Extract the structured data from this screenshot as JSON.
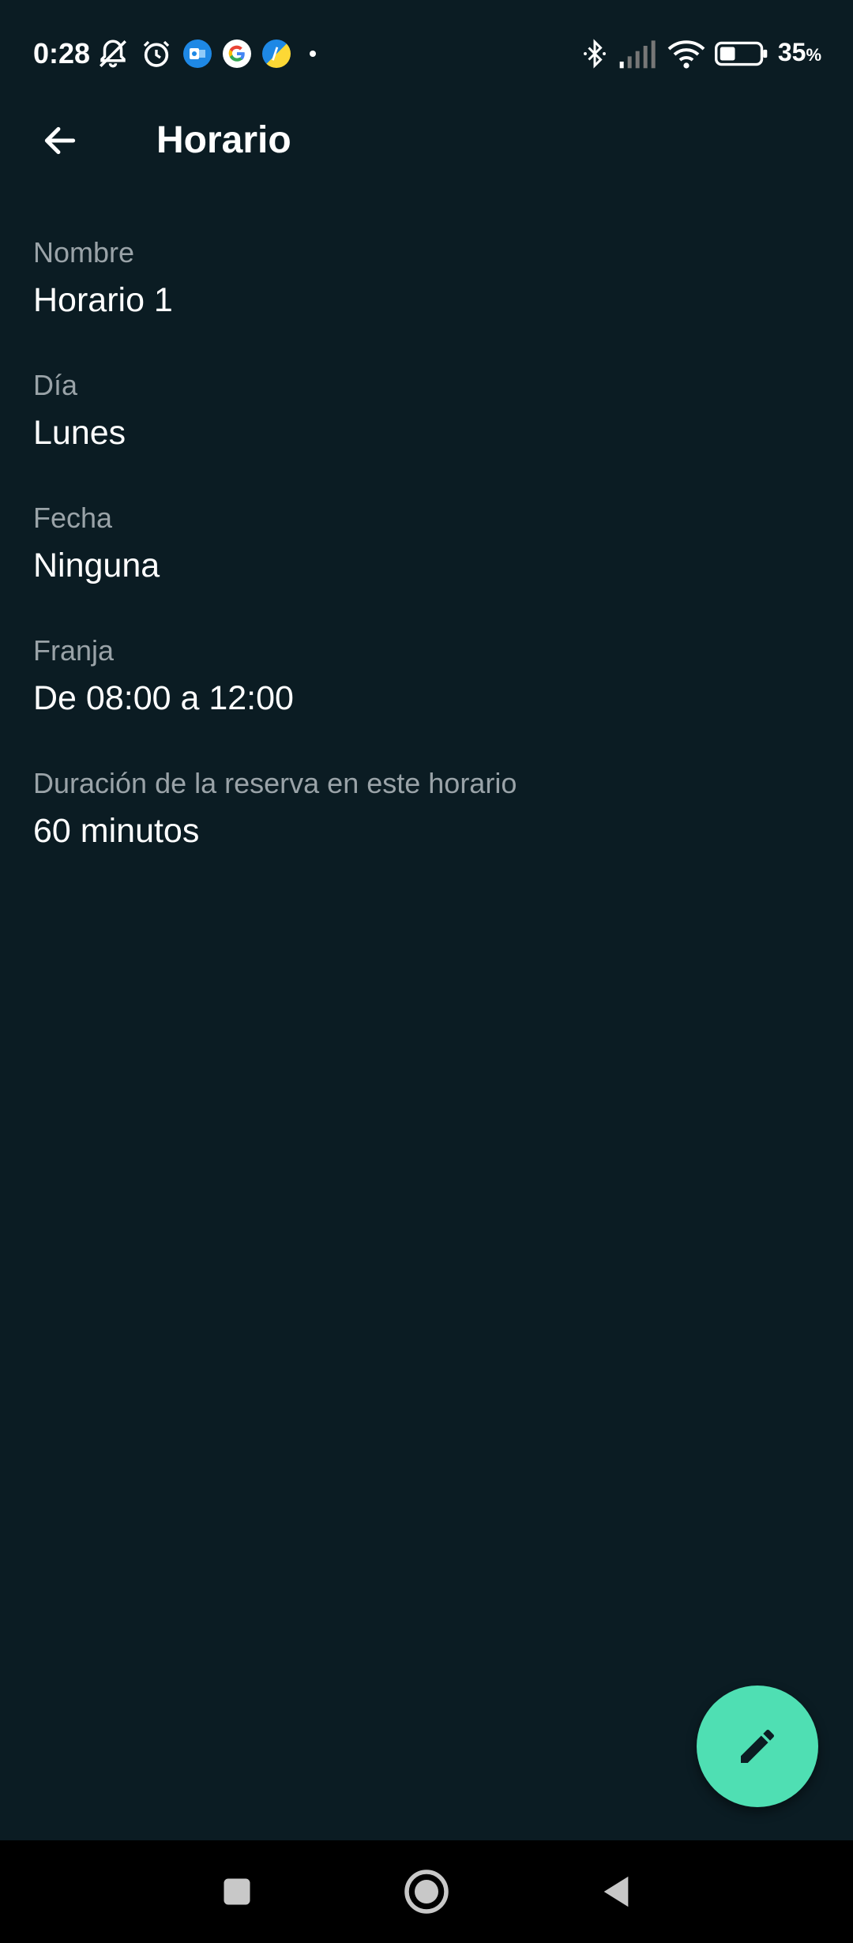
{
  "status_bar": {
    "time": "0:28",
    "battery_percent": "35",
    "battery_unit": "%",
    "icons_left": [
      "bell-off-icon",
      "alarm-icon",
      "outlook-icon",
      "google-icon",
      "app-icon",
      "dot-icon"
    ],
    "icons_right": [
      "bluetooth-icon",
      "signal-icon",
      "wifi-icon",
      "battery-icon"
    ]
  },
  "app_bar": {
    "title": "Horario",
    "back_icon": "arrow-left-icon"
  },
  "details": {
    "nombre": {
      "label": "Nombre",
      "value": "Horario 1"
    },
    "dia": {
      "label": "Día",
      "value": "Lunes"
    },
    "fecha": {
      "label": "Fecha",
      "value": "Ninguna"
    },
    "franja": {
      "label": "Franja",
      "value": "De 08:00 a 12:00"
    },
    "duracion": {
      "label": "Duración de la reserva en este horario",
      "value": "60 minutos"
    }
  },
  "fab": {
    "icon": "pencil-icon",
    "color": "#4fdfb3"
  },
  "nav_bar": {
    "icons": [
      "recents-square-icon",
      "home-circle-icon",
      "back-triangle-icon"
    ]
  },
  "colors": {
    "background": "#0b1c23",
    "label": "#9aa3a8",
    "value": "#ffffff",
    "accent": "#4fdfb3"
  }
}
